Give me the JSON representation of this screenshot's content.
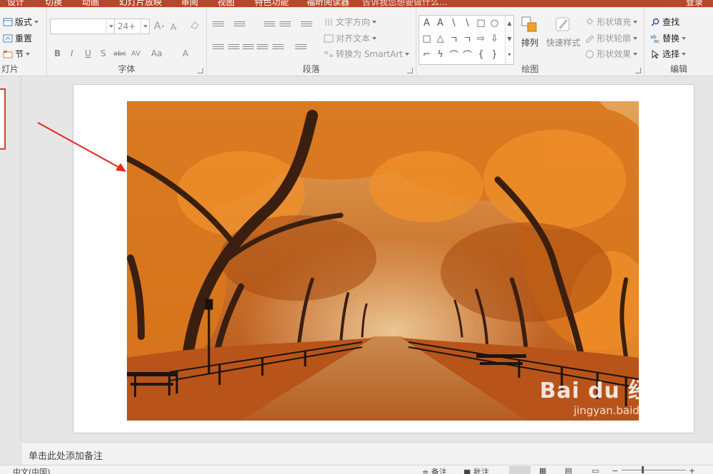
{
  "menu": {
    "tabs": [
      "设计",
      "切换",
      "动画",
      "幻灯片放映",
      "审阅",
      "视图",
      "特色功能",
      "福昕阅读器"
    ],
    "tell_me": "告诉我您想要做什么...",
    "login": "登录"
  },
  "ribbon": {
    "slides_group": {
      "layout": "版式",
      "reset": "重置",
      "section": "节",
      "label": "灯片"
    },
    "font_group": {
      "font_name": "",
      "font_size": "24+",
      "grow": "A",
      "shrink": "A",
      "bold": "B",
      "italic": "I",
      "underline": "U",
      "shadow": "S",
      "strike": "abc",
      "spacing": "AV",
      "case": "Aa",
      "color": "A",
      "label": "字体"
    },
    "para_group": {
      "text_direction": "文字方向",
      "align_text": "对齐文本",
      "smartart": "转换为 SmartArt",
      "label": "段落"
    },
    "draw_group": {
      "shapes_row1": [
        "A",
        "A",
        "\\",
        "\\",
        "□",
        "○"
      ],
      "shapes_row2": [
        "□",
        "△",
        "ㄱ",
        "ㄱ",
        "⇨",
        "⇩"
      ],
      "shapes_row3": [
        "⌐",
        "ϟ",
        "⌒",
        "⌒",
        "{",
        "}"
      ],
      "arrange": "排列",
      "quick_styles": "快速样式",
      "shape_fill": "形状填充",
      "shape_outline": "形状轮廓",
      "shape_effect": "形状效果",
      "label": "绘图"
    },
    "edit_group": {
      "find": "查找",
      "replace": "替换",
      "select": "选择",
      "label": "编辑"
    }
  },
  "notes_placeholder": "单击此处添加备注",
  "status": {
    "language": "中文(中国)",
    "notes": "备注",
    "comments": "批注"
  },
  "watermark": {
    "brand": "Bai du 经验",
    "url": "jingyan.baidu.com"
  },
  "colors": {
    "accent": "#b7472a",
    "arrow": "#e8261f"
  }
}
